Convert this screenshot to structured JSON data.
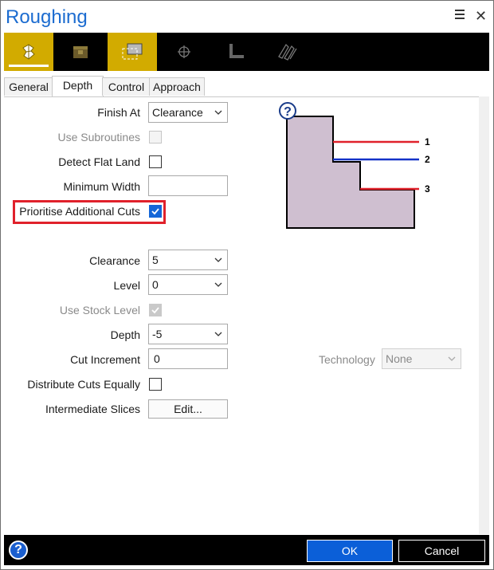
{
  "window": {
    "title": "Roughing"
  },
  "toolbar": {
    "tools": [
      {
        "icon": "roughing-surface-icon",
        "active": true,
        "selected": true
      },
      {
        "icon": "stock-block-icon",
        "active": false
      },
      {
        "icon": "boundary-select-icon",
        "active": true
      },
      {
        "icon": "crosshair-icon",
        "active": false
      },
      {
        "icon": "corner-profile-icon",
        "active": false
      },
      {
        "icon": "zigzag-pattern-icon",
        "active": false
      }
    ]
  },
  "tabs": [
    "General",
    "Depth",
    "Control",
    "Approach"
  ],
  "active_tab": "Depth",
  "form": {
    "finish_at": {
      "label": "Finish At",
      "value": "Clearance"
    },
    "use_subroutines": {
      "label": "Use Subroutines",
      "checked": false,
      "disabled": true
    },
    "detect_flat_land": {
      "label": "Detect Flat Land",
      "checked": false
    },
    "minimum_width": {
      "label": "Minimum Width",
      "value": ""
    },
    "prioritise_additional_cuts": {
      "label": "Prioritise Additional Cuts",
      "checked": true
    },
    "clearance": {
      "label": "Clearance",
      "value": "5"
    },
    "level": {
      "label": "Level",
      "value": "0"
    },
    "use_stock_level": {
      "label": "Use Stock Level",
      "checked": true,
      "disabled": true
    },
    "depth": {
      "label": "Depth",
      "value": "-5"
    },
    "cut_increment": {
      "label": "Cut Increment",
      "value": "0"
    },
    "distribute_cuts_equally": {
      "label": "Distribute Cuts Equally",
      "checked": false
    },
    "intermediate_slices": {
      "label": "Intermediate Slices",
      "button": "Edit..."
    },
    "technology": {
      "label": "Technology",
      "value": "None",
      "disabled": true
    }
  },
  "diagram": {
    "help_glyph": "?",
    "markers": [
      "1",
      "2",
      "3"
    ],
    "colors": {
      "stock": "#cfbfd0",
      "cut_red": "#e0212b",
      "cut_blue": "#1432c8"
    }
  },
  "footer": {
    "help": "?",
    "ok": "OK",
    "cancel": "Cancel"
  },
  "colors": {
    "accent": "#1c6cd0",
    "tool_active": "#d2ab00",
    "highlight_box": "#e0212b",
    "ok_button": "#0b5fd8"
  }
}
